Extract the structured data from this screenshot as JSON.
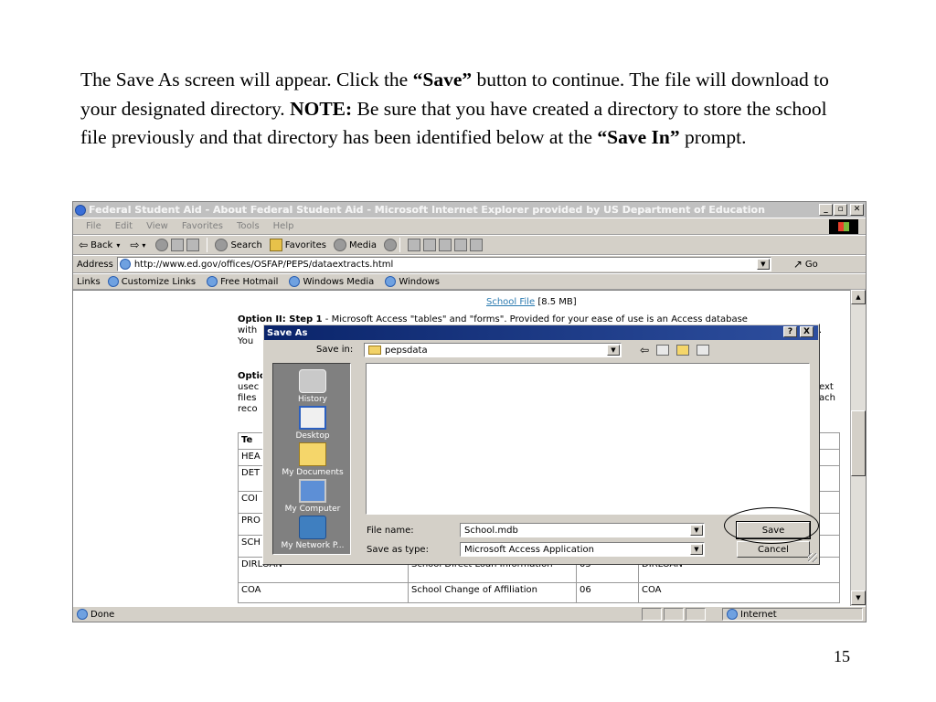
{
  "slide": {
    "p1": "The Save As screen will appear.  Click the ",
    "p1_bold": "“Save”",
    "p2": " button to continue.  The file will download to your designated directory.   ",
    "note": "NOTE:",
    "p3": "  Be sure that you have created a directory to store the school file previously and that directory has been identified below at the ",
    "p3_bold": "“Save In”",
    "p4": " prompt.",
    "page_number": "15"
  },
  "browser": {
    "title": "Federal Student Aid - About Federal Student Aid - Microsoft Internet Explorer provided by US Department of Education",
    "menu": [
      "File",
      "Edit",
      "View",
      "Favorites",
      "Tools",
      "Help"
    ],
    "toolbar": {
      "back": "Back",
      "search": "Search",
      "favorites": "Favorites",
      "media": "Media"
    },
    "address_label": "Address",
    "address_url": "http://www.ed.gov/offices/OSFAP/PEPS/dataextracts.html",
    "go": "Go",
    "links_label": "Links",
    "links": [
      "Customize Links",
      "Free Hotmail",
      "Windows Media",
      "Windows"
    ],
    "status_text": "Done",
    "status_zone": "Internet"
  },
  "page": {
    "school_file_link": "School File",
    "school_file_size": "[8.5 MB]",
    "option2_bold": "Option II: Step 1",
    "option2_text": " - Microsoft Access \"tables\" and \"forms\". Provided for your ease of use is an Access database",
    "line_with": "with",
    "line_with_right": "t.",
    "line_you": "You",
    "opti": "Optio",
    "usec": "usec",
    "files": "files",
    "reco": "reco",
    "ext": "ext",
    "ach": "ach",
    "table": {
      "rows": [
        [
          "Te",
          "",
          "",
          ""
        ],
        [
          "HEA",
          "",
          "",
          ""
        ],
        [
          "DET",
          "",
          "",
          ""
        ],
        [
          "COI",
          "",
          "",
          ""
        ],
        [
          "PRO",
          "",
          "",
          ""
        ],
        [
          "SCH",
          "",
          "",
          ""
        ],
        [
          "DIRLOAN",
          "School Direct Loan Information",
          "05",
          "DIRLOAN"
        ],
        [
          "COA",
          "School Change of Affiliation",
          "06",
          "COA"
        ]
      ]
    }
  },
  "dialog": {
    "title": "Save As",
    "title_buttons": [
      "?",
      "X"
    ],
    "save_in_label": "Save in:",
    "save_in_value": "pepsdata",
    "places": [
      "History",
      "Desktop",
      "My Documents",
      "My Computer",
      "My Network P..."
    ],
    "file_name_label": "File name:",
    "file_name_value": "School.mdb",
    "save_as_type_label": "Save as type:",
    "save_as_type_value": "Microsoft Access Application",
    "save_button": "Save",
    "cancel_button": "Cancel"
  }
}
